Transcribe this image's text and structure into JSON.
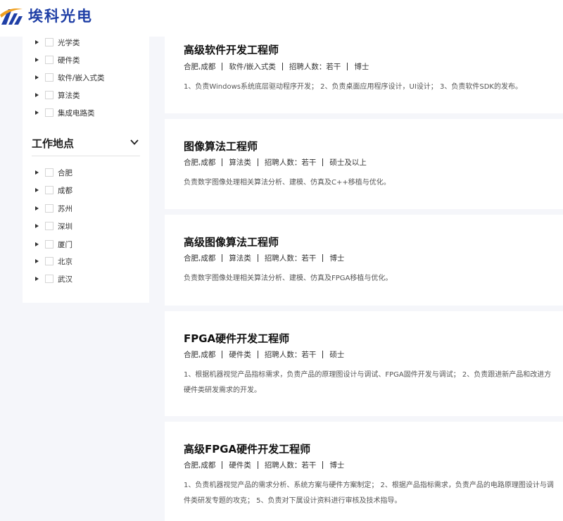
{
  "brand": {
    "name": "埃科光电",
    "accent": "#1f3fa6",
    "mark_accent": "#f0a020"
  },
  "filters": {
    "categories": [
      {
        "label": "光学类"
      },
      {
        "label": "硬件类"
      },
      {
        "label": "软件/嵌入式类"
      },
      {
        "label": "算法类"
      },
      {
        "label": "集成电路类"
      }
    ],
    "location_title": "工作地点",
    "locations": [
      {
        "label": "合肥"
      },
      {
        "label": "成都"
      },
      {
        "label": "苏州"
      },
      {
        "label": "深圳"
      },
      {
        "label": "厦门"
      },
      {
        "label": "北京"
      },
      {
        "label": "武汉"
      }
    ]
  },
  "jobs": [
    {
      "title": "高级软件开发工程师",
      "location": "合肥,成都",
      "category": "软件/嵌入式类",
      "headcount": "招聘人数：若干",
      "education": "博士",
      "desc": [
        "1、负责Windows系统底层驱动程序开发； 2、负责桌面应用程序设计，UI设计； 3、负责软件SDK的发布。"
      ]
    },
    {
      "title": "图像算法工程师",
      "location": "合肥,成都",
      "category": "算法类",
      "headcount": "招聘人数：若干",
      "education": "硕士及以上",
      "desc": [
        "负责数字图像处理相关算法分析、建模、仿真及C++移植与优化。"
      ]
    },
    {
      "title": "高级图像算法工程师",
      "location": "合肥,成都",
      "category": "算法类",
      "headcount": "招聘人数：若干",
      "education": "博士",
      "desc": [
        "负责数字图像处理相关算法分析、建模、仿真及FPGA移植与优化。"
      ]
    },
    {
      "title": "FPGA硬件开发工程师",
      "location": "合肥,成都",
      "category": "硬件类",
      "headcount": "招聘人数：若干",
      "education": "硕士",
      "desc": [
        "1、根据机器视觉产品指标需求，负责产品的原理图设计与调试、FPGA固件开发与调试； 2、负责跟进新产品和改进方",
        "硬件类研发需求的开发。"
      ]
    },
    {
      "title": "高级FPGA硬件开发工程师",
      "location": "合肥,成都",
      "category": "硬件类",
      "headcount": "招聘人数：若干",
      "education": "博士",
      "desc": [
        "1、负责机器视觉产品的需求分析、系统方案与硬件方案制定； 2、根据产品指标需求，负责产品的电路原理图设计与调",
        "件类研发专题的攻克； 5、负责对下属设计资料进行审核及技术指导。"
      ]
    }
  ]
}
